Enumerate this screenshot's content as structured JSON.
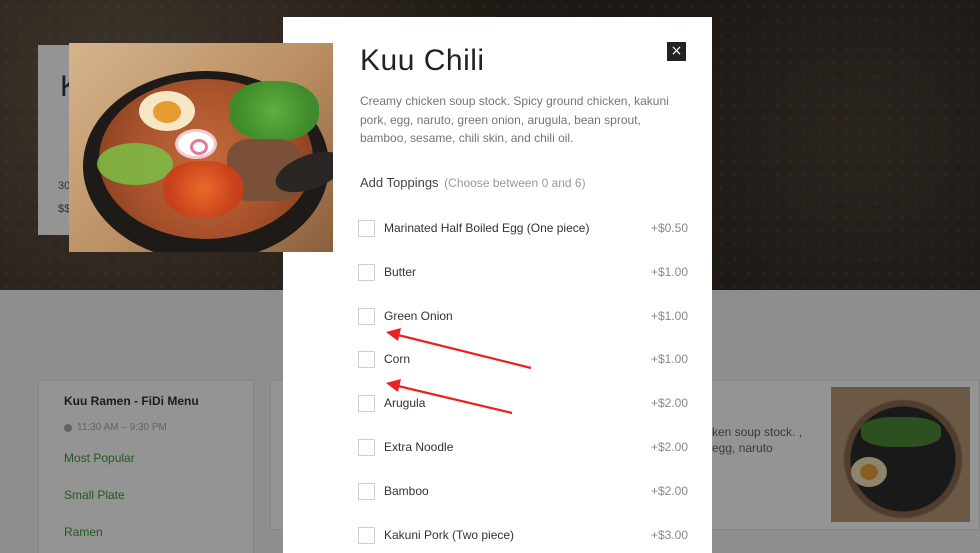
{
  "background": {
    "restaurant_title_partial": "K",
    "meta_line1": "30",
    "meta_line2": "$$",
    "menu_title": "Kuu Ramen - FiDi Menu",
    "menu_hours": "11:30 AM – 9:30 PM",
    "menu_links": [
      "Most Popular",
      "Small Plate",
      "Ramen"
    ],
    "item_desc_partial": "ken soup stock. , egg, naruto"
  },
  "modal": {
    "title": "Kuu Chili",
    "description": "Creamy chicken soup stock. Spicy ground chicken, kakuni pork, egg, naruto, green onion, arugula, bean sprout, bamboo, sesame, chili skin, and chili oil.",
    "close_label": "×",
    "section_title": "Add Toppings",
    "section_hint": "(Choose between 0 and 6)",
    "options": [
      {
        "label": "Marinated Half Boiled Egg (One piece)",
        "price": "+$0.50"
      },
      {
        "label": "Butter",
        "price": "+$1.00"
      },
      {
        "label": "Green Onion",
        "price": "+$1.00"
      },
      {
        "label": "Corn",
        "price": "+$1.00"
      },
      {
        "label": "Arugula",
        "price": "+$2.00"
      },
      {
        "label": "Extra Noodle",
        "price": "+$2.00"
      },
      {
        "label": "Bamboo",
        "price": "+$2.00"
      },
      {
        "label": "Kakuni Pork (Two piece)",
        "price": "+$3.00"
      }
    ]
  },
  "annotation_color": "#e8231f"
}
